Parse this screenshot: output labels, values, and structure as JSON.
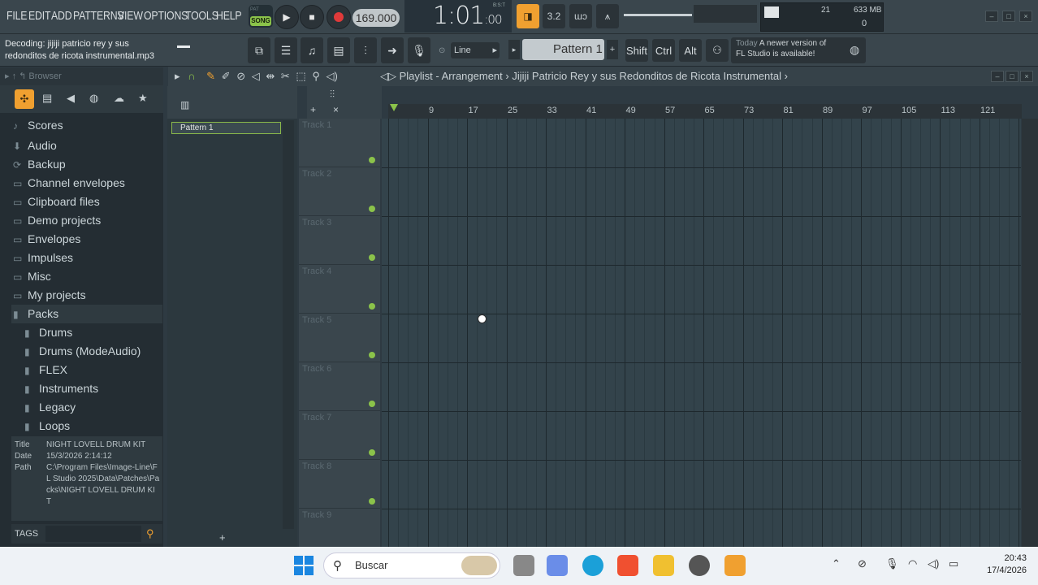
{
  "menu": [
    "FILE",
    "EDIT",
    "ADD",
    "PATTERNS",
    "VIEW",
    "OPTIONS",
    "TOOLS",
    "HELP"
  ],
  "transport": {
    "pat_label": "PAT",
    "song_label": "SONG",
    "tempo": "169.000"
  },
  "time": {
    "main": "1:01",
    "sub": ":00",
    "bst": "B:S:T"
  },
  "monitor": {
    "voices": "21",
    "memory": "633 MB",
    "cpu": "0"
  },
  "hint": {
    "line1": "Decoding: jijiji  patricio rey y sus",
    "line2": "redonditos de ricota  instrumental.mp3"
  },
  "snap": "Line",
  "pattern_selector": "Pattern 1",
  "modifiers": [
    "Shift",
    "Ctrl",
    "Alt"
  ],
  "news": {
    "when": "Today",
    "line1": "A newer version of",
    "line2": "FL Studio is available!"
  },
  "browser": {
    "title": "Browser",
    "items": [
      {
        "label": "Scores",
        "icon": "♪"
      },
      {
        "label": "Audio",
        "icon": "⬇"
      },
      {
        "label": "Backup",
        "icon": "⟳"
      },
      {
        "label": "Channel envelopes",
        "icon": "▭"
      },
      {
        "label": "Clipboard files",
        "icon": "▭"
      },
      {
        "label": "Demo projects",
        "icon": "▭"
      },
      {
        "label": "Envelopes",
        "icon": "▭"
      },
      {
        "label": "Impulses",
        "icon": "▭"
      },
      {
        "label": "Misc",
        "icon": "▭"
      },
      {
        "label": "My projects",
        "icon": "▭"
      },
      {
        "label": "Packs",
        "icon": "▮"
      }
    ],
    "subitems": [
      "Drums",
      "Drums (ModeAudio)",
      "FLEX",
      "Instruments",
      "Legacy",
      "Loops"
    ],
    "info": {
      "title_label": "Title",
      "title": "NIGHT LOVELL DRUM KIT",
      "date_label": "Date",
      "date": "15/3/2026 2:14:12",
      "path_label": "Path",
      "path": "C:\\Program Files\\Image-Line\\FL Studio 2025\\Data\\Patches\\Packs\\NIGHT LOVELL DRUM KIT"
    },
    "tags": "TAGS"
  },
  "playlist": {
    "title": "Playlist - Arrangement",
    "crumb": "Jijiji  Patricio Rey y sus Redonditos de Ricota  Instrumental",
    "pattern": "Pattern 1",
    "tracks": [
      "Track 1",
      "Track 2",
      "Track 3",
      "Track 4",
      "Track 5",
      "Track 6",
      "Track 7",
      "Track 8",
      "Track 9"
    ],
    "ruler": [
      "9",
      "17",
      "25",
      "33",
      "41",
      "49",
      "57",
      "65",
      "73",
      "81",
      "89",
      "97",
      "105",
      "113",
      "121"
    ]
  },
  "taskbar": {
    "search": "Buscar",
    "time": "20:43",
    "date": "17/4/2026"
  },
  "colors": {
    "accent": "#8bc34a",
    "orange": "#f0a030",
    "bg": "#2e3a42"
  }
}
